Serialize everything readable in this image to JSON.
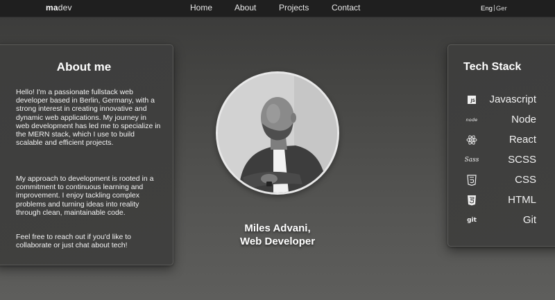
{
  "nav": {
    "logo_bold": "ma",
    "logo_rest": "dev",
    "links": [
      "Home",
      "About",
      "Projects",
      "Contact"
    ],
    "lang_active": "Eng",
    "lang_other": "Ger"
  },
  "about": {
    "title": "About me",
    "paragraphs": [
      "Hello! I'm a passionate fullstack web developer based in Berlin, Germany, with a strong interest in creating innovative and dynamic web applications. My journey in web development has led me to specialize in the MERN stack, which I use to build scalable and efficient projects.",
      "My approach to development is rooted in a commitment to continuous learning and improvement. I enjoy tackling complex problems and turning ideas into reality through clean, maintainable code.",
      "Feel free to reach out if you'd like to collaborate or just chat about tech!"
    ]
  },
  "profile": {
    "name_line": "Miles Advani,",
    "role_line": "Web Developer"
  },
  "tech": {
    "title": "Tech Stack",
    "items": [
      {
        "label": "Javascript",
        "icon": "javascript-icon",
        "icon_text": "JS"
      },
      {
        "label": "Node",
        "icon": "node-icon",
        "icon_text": "node"
      },
      {
        "label": "React",
        "icon": "react-icon",
        "icon_text": ""
      },
      {
        "label": "SCSS",
        "icon": "sass-icon",
        "icon_text": "Sass"
      },
      {
        "label": "CSS",
        "icon": "css3-icon",
        "icon_text": ""
      },
      {
        "label": "HTML",
        "icon": "html5-icon",
        "icon_text": ""
      },
      {
        "label": "Git",
        "icon": "git-icon",
        "icon_text": "git"
      }
    ]
  },
  "colors": {
    "topbar": "#1f1f1f",
    "card": "#3f3f3e",
    "text": "#ffffff"
  }
}
